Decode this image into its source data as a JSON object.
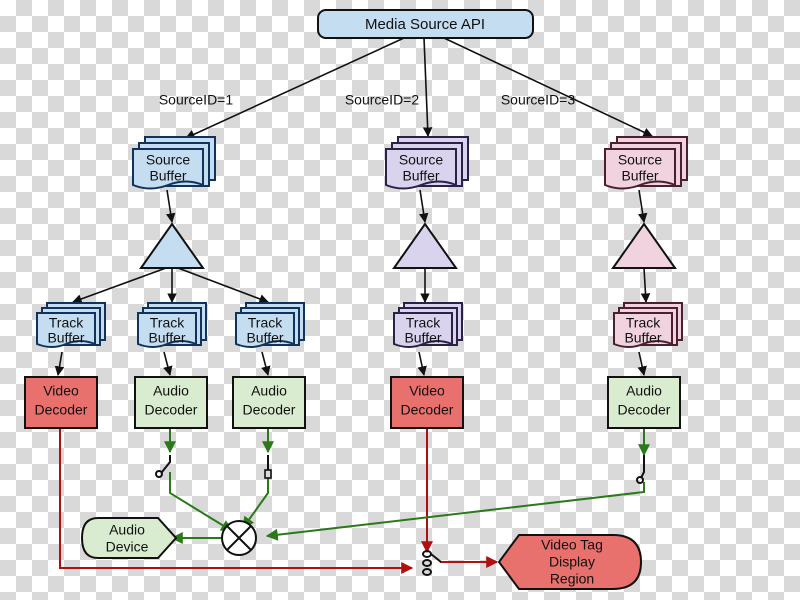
{
  "diagram": {
    "title": "Media Source API pipeline",
    "background": "transparency-checkerboard",
    "colors": {
      "blue_fill": "#c5ddf0",
      "blue_stroke": "#11335a",
      "purple_fill": "#d9d3ee",
      "purple_stroke": "#2b2147",
      "pink_fill": "#f0d3de",
      "pink_stroke": "#4a2030",
      "red_fill": "#e8706d",
      "red_stroke": "#111111",
      "green_fill": "#d9ecd0",
      "green_stroke": "#111111",
      "black_edge": "#111111",
      "red_edge": "#b01010",
      "green_edge": "#2a7a1a"
    }
  },
  "root": {
    "id": "media-source-api",
    "label": "Media Source API",
    "shape": "rounded-rectangle",
    "fill": "#c5ddf0"
  },
  "edge_labels": [
    {
      "id": "source-id-1",
      "text": "SourceID=1"
    },
    {
      "id": "source-id-2",
      "text": "SourceID=2"
    },
    {
      "id": "source-id-3",
      "text": "SourceID=3"
    }
  ],
  "source_buffers": [
    {
      "id": "source-buffer-1",
      "line1": "Source",
      "line2": "Buffer",
      "fill": "#c5ddf0",
      "stroke": "#11335a"
    },
    {
      "id": "source-buffer-2",
      "line1": "Source",
      "line2": "Buffer",
      "fill": "#d9d3ee",
      "stroke": "#2b2147"
    },
    {
      "id": "source-buffer-3",
      "line1": "Source",
      "line2": "Buffer",
      "fill": "#f0d3de",
      "stroke": "#4a2030"
    }
  ],
  "demuxers": [
    {
      "id": "demuxer-1",
      "shape": "triangle",
      "fill": "#c5ddf0",
      "stroke": "#111111"
    },
    {
      "id": "demuxer-2",
      "shape": "triangle",
      "fill": "#d9d3ee",
      "stroke": "#111111"
    },
    {
      "id": "demuxer-3",
      "shape": "triangle",
      "fill": "#f0d3de",
      "stroke": "#111111"
    }
  ],
  "track_buffers": [
    {
      "id": "track-buffer-1",
      "line1": "Track",
      "line2": "Buffer",
      "fill": "#c5ddf0",
      "stroke": "#11335a"
    },
    {
      "id": "track-buffer-2",
      "line1": "Track",
      "line2": "Buffer",
      "fill": "#c5ddf0",
      "stroke": "#11335a"
    },
    {
      "id": "track-buffer-3",
      "line1": "Track",
      "line2": "Buffer",
      "fill": "#c5ddf0",
      "stroke": "#11335a"
    },
    {
      "id": "track-buffer-4",
      "line1": "Track",
      "line2": "Buffer",
      "fill": "#d9d3ee",
      "stroke": "#2b2147"
    },
    {
      "id": "track-buffer-5",
      "line1": "Track",
      "line2": "Buffer",
      "fill": "#f0d3de",
      "stroke": "#4a2030"
    }
  ],
  "decoders": [
    {
      "id": "video-decoder-1",
      "line1": "Video",
      "line2": "Decoder",
      "kind": "video",
      "fill": "#e8706d"
    },
    {
      "id": "audio-decoder-1",
      "line1": "Audio",
      "line2": "Decoder",
      "kind": "audio",
      "fill": "#d9ecd0"
    },
    {
      "id": "audio-decoder-2",
      "line1": "Audio",
      "line2": "Decoder",
      "kind": "audio",
      "fill": "#d9ecd0"
    },
    {
      "id": "video-decoder-2",
      "line1": "Video",
      "line2": "Decoder",
      "kind": "video",
      "fill": "#e8706d"
    },
    {
      "id": "audio-decoder-3",
      "line1": "Audio",
      "line2": "Decoder",
      "kind": "audio",
      "fill": "#d9ecd0"
    }
  ],
  "sinks": {
    "audio_device": {
      "id": "audio-device",
      "line1": "Audio",
      "line2": "Device",
      "fill": "#d9ecd0"
    },
    "video_tag": {
      "id": "video-tag-display-region",
      "line1": "Video Tag",
      "line2": "Display",
      "line3": "Region",
      "fill": "#e8706d"
    }
  },
  "mixer": {
    "id": "audio-mixer",
    "shape": "circle-x"
  },
  "switches": [
    {
      "id": "audio-switch-1",
      "state": "open"
    },
    {
      "id": "audio-switch-2",
      "state": "closed"
    },
    {
      "id": "audio-switch-3",
      "state": "closed"
    },
    {
      "id": "video-switch",
      "state": "selector-3-position"
    }
  ]
}
